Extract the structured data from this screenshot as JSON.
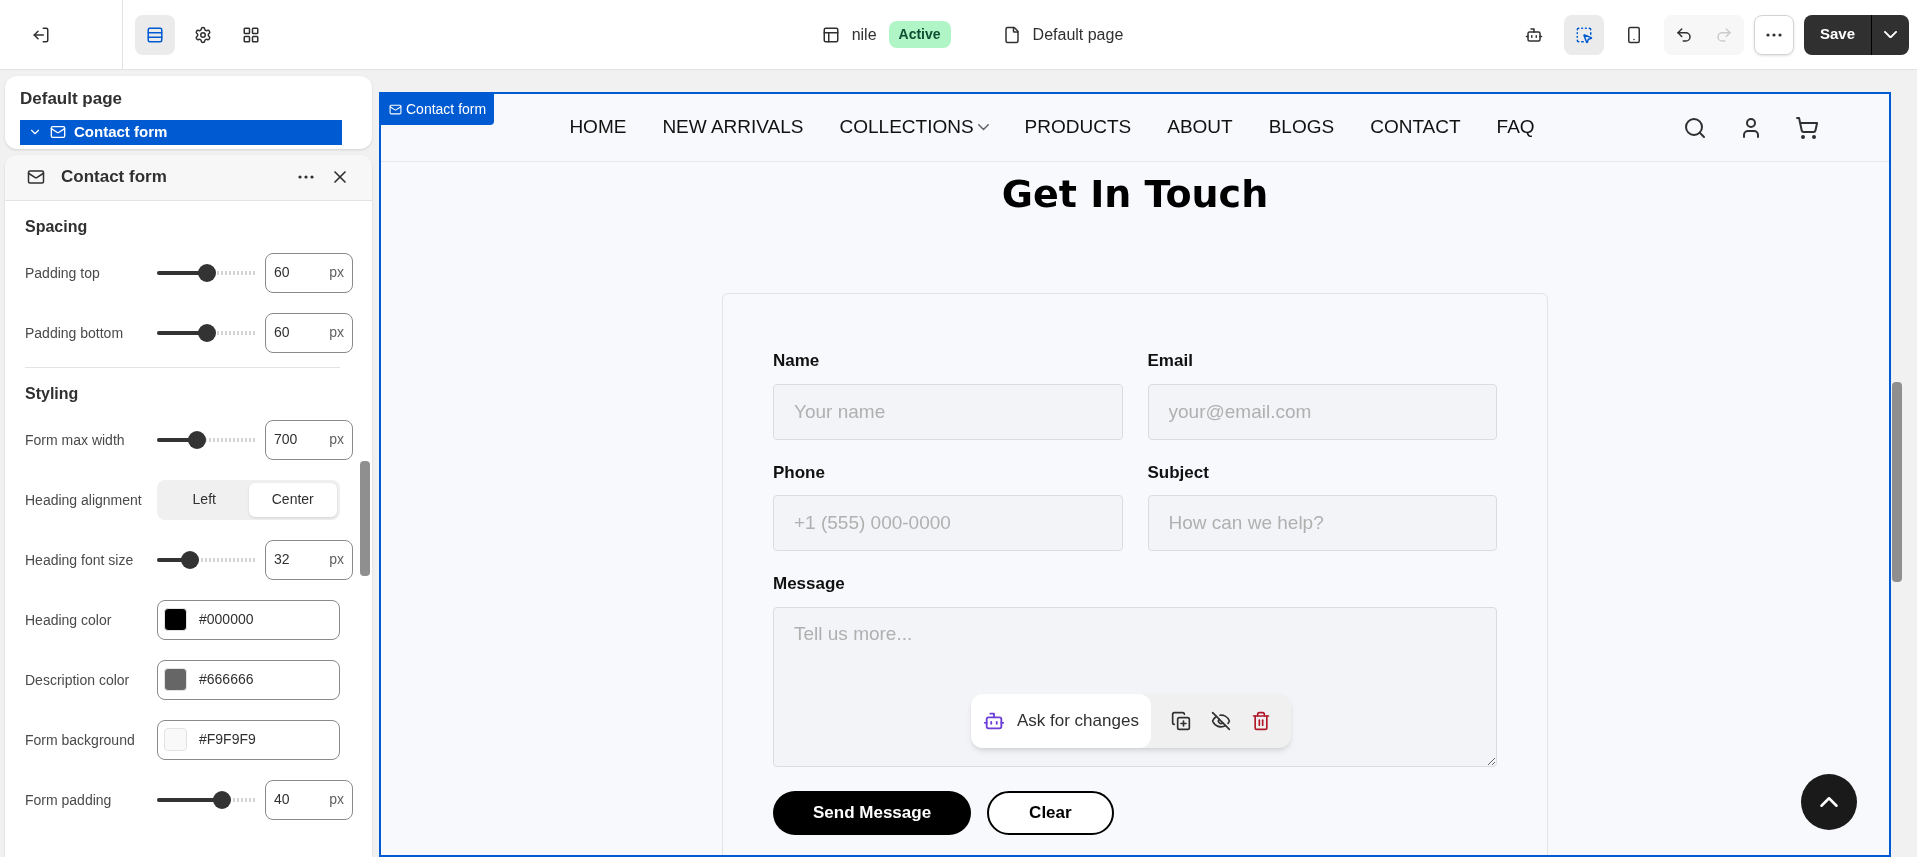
{
  "topbar": {
    "tools": [
      {
        "kind": "sections",
        "selected": true
      },
      {
        "kind": "settings",
        "selected": false
      },
      {
        "kind": "apps",
        "selected": false
      }
    ],
    "site": {
      "name": "nile",
      "status": "Active"
    },
    "page": "Default page",
    "view_tools": [
      {
        "kind": "ai",
        "selected": false
      },
      {
        "kind": "inspect",
        "selected": true
      },
      {
        "kind": "mobile",
        "selected": false
      }
    ],
    "undo_disabled": false,
    "redo_disabled": true,
    "save": "Save"
  },
  "outline": {
    "title": "Default page",
    "items": [
      {
        "label": "Contact form",
        "selected": true,
        "expanded": true
      }
    ]
  },
  "panel": {
    "title": "Contact form",
    "sections": [
      {
        "title": "Spacing",
        "settings": [
          {
            "kind": "slider",
            "label": "Padding top",
            "level": 0.5,
            "value": "60",
            "unit": "px"
          },
          {
            "kind": "slider",
            "label": "Padding bottom",
            "level": 0.5,
            "value": "60",
            "unit": "px"
          }
        ]
      },
      {
        "title": "Styling",
        "settings": [
          {
            "kind": "slider",
            "label": "Form max width",
            "level": 0.4,
            "value": "700",
            "unit": "px"
          },
          {
            "kind": "segmented",
            "label": "Heading alignment",
            "options": [
              {
                "label": "Left",
                "selected": false
              },
              {
                "label": "Center",
                "selected": true
              }
            ]
          },
          {
            "kind": "slider",
            "label": "Heading font size",
            "level": 0.33,
            "value": "32",
            "unit": "px"
          },
          {
            "kind": "color",
            "label": "Heading color",
            "value": "#000000",
            "color": "#000000"
          },
          {
            "kind": "color",
            "label": "Description color",
            "value": "#666666",
            "color": "#666666"
          },
          {
            "kind": "color",
            "label": "Form background",
            "value": "#F9F9F9",
            "color": "#f9f9f9"
          },
          {
            "kind": "slider",
            "label": "Form padding",
            "level": 0.65,
            "value": "40",
            "unit": "px"
          }
        ]
      }
    ]
  },
  "preview": {
    "section_badge": "Contact form",
    "nav": [
      {
        "label": "HOME",
        "dropdown": false
      },
      {
        "label": "NEW ARRIVALS",
        "dropdown": false
      },
      {
        "label": "COLLECTIONS",
        "dropdown": true
      },
      {
        "label": "PRODUCTS",
        "dropdown": false
      },
      {
        "label": "ABOUT",
        "dropdown": false
      },
      {
        "label": "BLOGS",
        "dropdown": false
      },
      {
        "label": "CONTACT",
        "dropdown": false
      },
      {
        "label": "FAQ",
        "dropdown": false
      }
    ],
    "heading": "Get In Touch",
    "fields": [
      {
        "kind": "input",
        "label": "Name",
        "placeholder": "Your name"
      },
      {
        "kind": "input",
        "label": "Email",
        "placeholder": "your@email.com"
      },
      {
        "kind": "input",
        "label": "Phone",
        "placeholder": "+1 (555) 000-0000"
      },
      {
        "kind": "input",
        "label": "Subject",
        "placeholder": "How can we help?"
      },
      {
        "kind": "textarea",
        "label": "Message",
        "placeholder": "Tell us more..."
      }
    ],
    "buttons": [
      {
        "kind": "primary",
        "label": "Send Message"
      },
      {
        "kind": "outline",
        "label": "Clear"
      }
    ],
    "ai_toolbar": {
      "prompt": "Ask for changes"
    }
  }
}
